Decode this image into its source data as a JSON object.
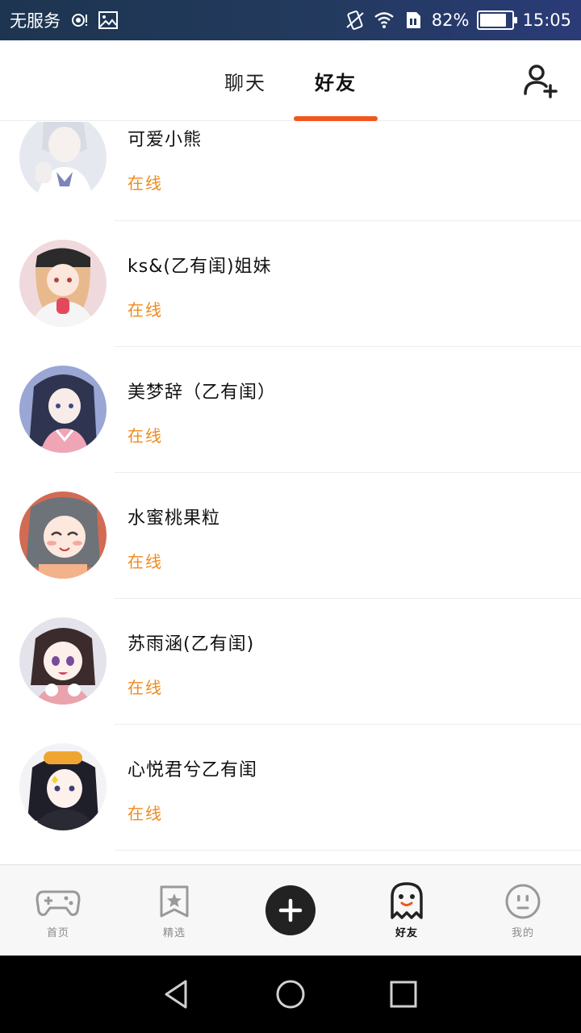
{
  "status_bar": {
    "carrier": "无服务",
    "battery_text": "82%",
    "battery_level": 0.82,
    "time": "15:05",
    "icons": [
      "hotspot-icon",
      "image-icon",
      "vibrate-icon",
      "wifi-icon",
      "sim-icon",
      "battery-icon"
    ]
  },
  "header": {
    "tabs": [
      {
        "label": "聊天",
        "active": false
      },
      {
        "label": "好友",
        "active": true
      }
    ],
    "add_friend_icon": "add-user-icon"
  },
  "friends": [
    {
      "name": "可爱小熊",
      "status": "在线"
    },
    {
      "name": "ks&(乙有闺)姐妹",
      "status": "在线"
    },
    {
      "name": "美梦辞（乙有闺）",
      "status": "在线"
    },
    {
      "name": "水蜜桃果粒",
      "status": "在线"
    },
    {
      "name": "苏雨涵(乙有闺)",
      "status": "在线"
    },
    {
      "name": "心悦君兮乙有闺",
      "status": "在线"
    }
  ],
  "bottom_nav": {
    "items": [
      {
        "label": "首页",
        "icon": "gamepad-icon",
        "active": false
      },
      {
        "label": "精选",
        "icon": "star-bookmark-icon",
        "active": false
      },
      {
        "label": "",
        "icon": "plus-icon",
        "active": false
      },
      {
        "label": "好友",
        "icon": "ghost-icon",
        "active": true
      },
      {
        "label": "我的",
        "icon": "face-icon",
        "active": false
      }
    ]
  },
  "colors": {
    "accent": "#f4551d",
    "online": "#f08a1c",
    "status_bar": "#233a5e"
  }
}
